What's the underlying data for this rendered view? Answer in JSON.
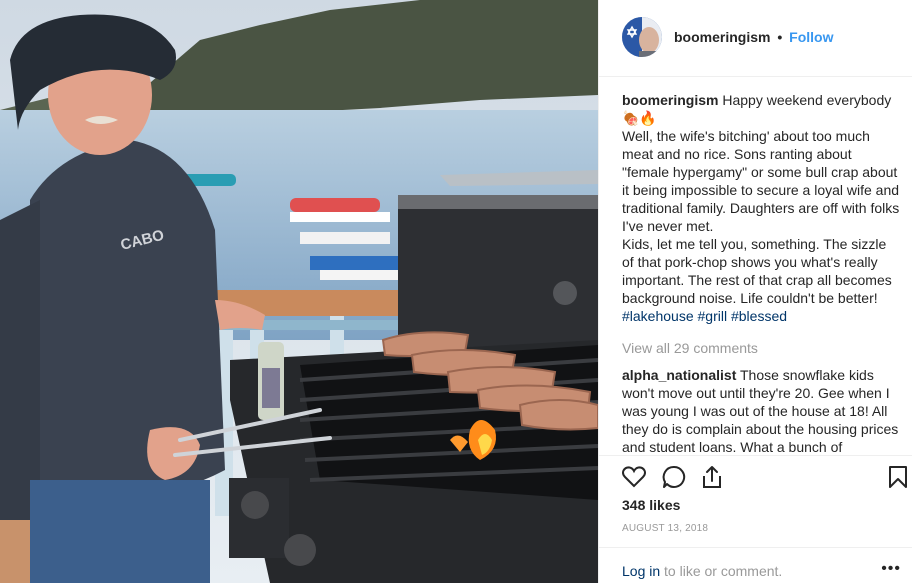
{
  "post": {
    "username": "boomeringism",
    "follow_label": "Follow",
    "dot": "•",
    "caption_title": "Happy weekend everybody",
    "caption_emoji": "🍖🔥",
    "caption_body": "Well, the wife's bitching' about too much meat and no rice. Sons ranting about \"female hypergamy\" or some bull crap about it being impossible to secure a loyal wife and traditional family. Daughters are off with folks I've never met.",
    "caption_body2": "Kids, let me tell you, something. The sizzle of that pork-chop shows you what's really important. The rest of that crap all becomes background noise. Life couldn't be better!",
    "hashtags": [
      "#lakehouse",
      "#grill",
      "#blessed"
    ],
    "view_all": "View all 29 comments",
    "comment": {
      "username": "alpha_nationalist",
      "text": "Those snowflake kids won't move out until they're 20. Gee when I was young I was out of the house at 18! All they do is complain about the housing prices and student loans. What a bunch of"
    },
    "likes": "348 likes",
    "date": "AUGUST 13, 2018",
    "login_link": "Log in",
    "login_suffix": " to like or comment.",
    "more": "•••"
  },
  "photo": {
    "shirt_text": "CABO"
  },
  "icons": [
    "heart-icon",
    "comment-icon",
    "share-icon",
    "bookmark-icon"
  ]
}
